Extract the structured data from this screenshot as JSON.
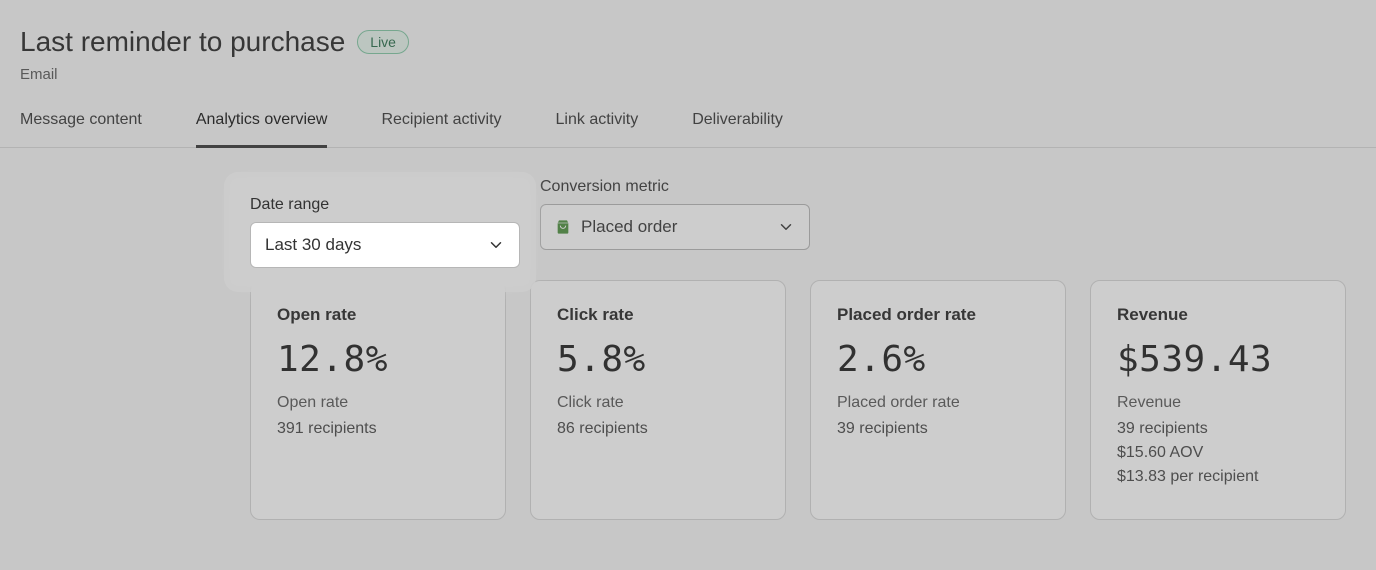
{
  "header": {
    "title": "Last reminder to purchase",
    "status_badge": "Live",
    "subtitle": "Email"
  },
  "tabs": [
    {
      "label": "Message content",
      "active": false
    },
    {
      "label": "Analytics overview",
      "active": true
    },
    {
      "label": "Recipient activity",
      "active": false
    },
    {
      "label": "Link activity",
      "active": false
    },
    {
      "label": "Deliverability",
      "active": false
    }
  ],
  "filters": {
    "date_range": {
      "label": "Date range",
      "value": "Last 30 days"
    },
    "conversion_metric": {
      "label": "Conversion metric",
      "value": "Placed order",
      "icon": "shopping-bag"
    }
  },
  "metrics": [
    {
      "title": "Open rate",
      "value": "12.8%",
      "sub": "Open rate",
      "lines": [
        "391 recipients"
      ]
    },
    {
      "title": "Click rate",
      "value": "5.8%",
      "sub": "Click rate",
      "lines": [
        "86 recipients"
      ]
    },
    {
      "title": "Placed order rate",
      "value": "2.6%",
      "sub": "Placed order rate",
      "lines": [
        "39 recipients"
      ]
    },
    {
      "title": "Revenue",
      "value": "$539.43",
      "sub": "Revenue",
      "lines": [
        "39 recipients",
        "$15.60 AOV",
        "$13.83 per recipient"
      ]
    }
  ]
}
